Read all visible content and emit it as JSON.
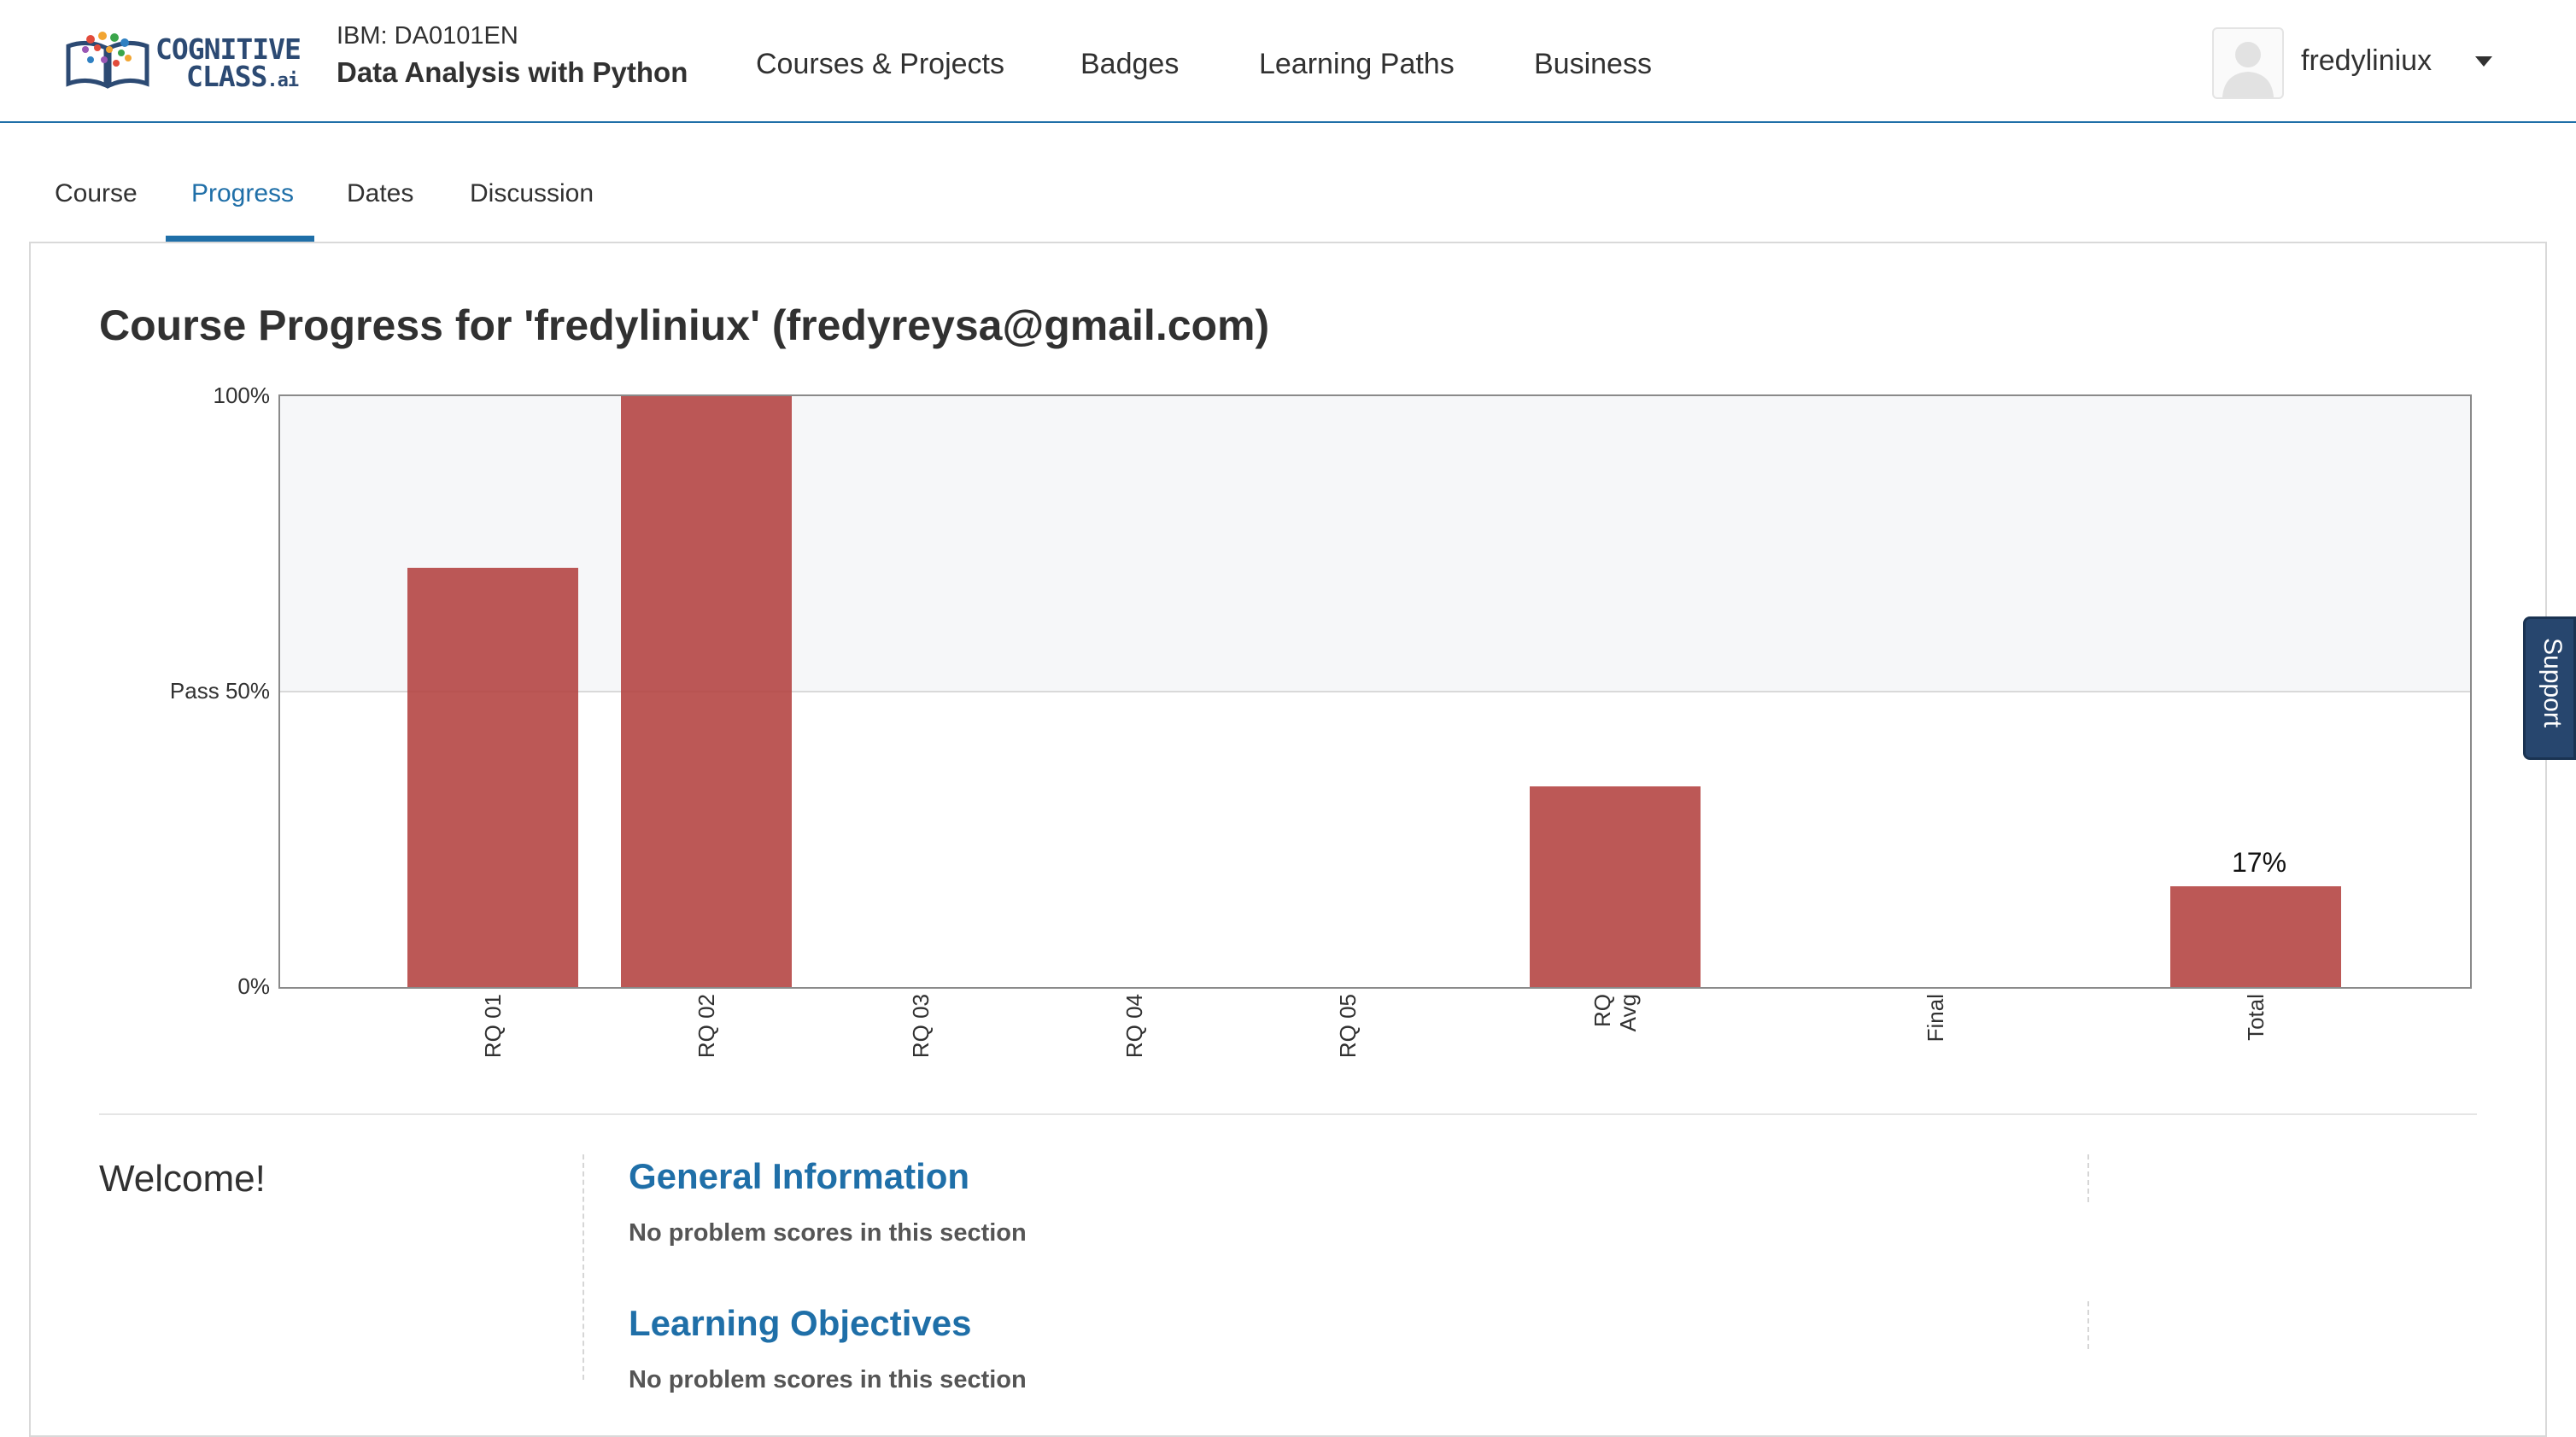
{
  "header": {
    "logo": {
      "line1": "COGNITIVE",
      "line2": "CLASS",
      "suffix": ".ai"
    },
    "course_code": "IBM: DA0101EN",
    "course_name": "Data Analysis with Python",
    "nav": [
      {
        "label": "Courses & Projects"
      },
      {
        "label": "Badges"
      },
      {
        "label": "Learning Paths"
      },
      {
        "label": "Business"
      }
    ],
    "username": "fredyliniux"
  },
  "tabs": [
    {
      "label": "Course"
    },
    {
      "label": "Progress",
      "active": true
    },
    {
      "label": "Dates"
    },
    {
      "label": "Discussion"
    }
  ],
  "main": {
    "title": "Course Progress for 'fredyliniux' (fredyreysa@gmail.com)"
  },
  "chart_data": {
    "type": "bar",
    "categories": [
      "RQ 01",
      "RQ 02",
      "RQ 03",
      "RQ 04",
      "RQ 05",
      "RQ\nAvg",
      "Final",
      "Total"
    ],
    "values": [
      71,
      100,
      0,
      0,
      0,
      34,
      0,
      17
    ],
    "value_labels": {
      "Total": "17%"
    },
    "y_ticks": [
      {
        "value": 100,
        "label": "100%"
      },
      {
        "value": 50,
        "label": "Pass 50%"
      },
      {
        "value": 0,
        "label": "0%"
      }
    ],
    "ylim": [
      0,
      100
    ],
    "pass_threshold": 50,
    "bar_color": "#b3413f",
    "title": "",
    "xlabel": "",
    "ylabel": ""
  },
  "support_label": "Support",
  "welcome": "Welcome!",
  "sections": [
    {
      "title": "General Information",
      "note": "No problem scores in this section"
    },
    {
      "title": "Learning Objectives",
      "note": "No problem scores in this section"
    }
  ],
  "colors": {
    "accent": "#1f6fa8",
    "bar": "#b3413f",
    "support_bg": "#27466e"
  }
}
